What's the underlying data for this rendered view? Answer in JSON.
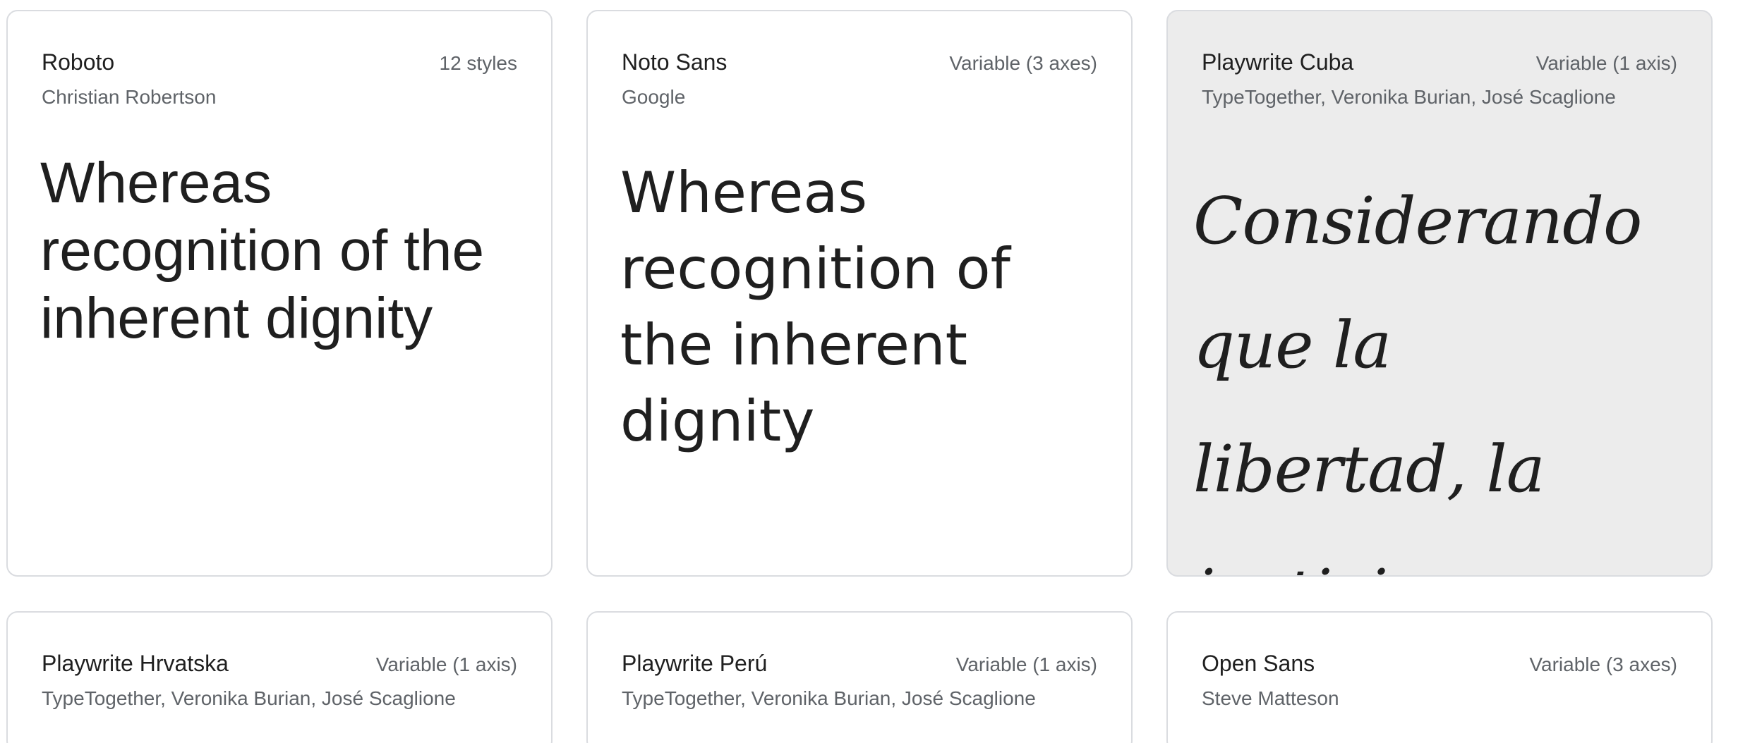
{
  "cards": [
    {
      "family": "Roboto",
      "styles": "12 styles",
      "designer": "Christian Robertson",
      "sample": "Whereas recognition of the inherent dignity"
    },
    {
      "family": "Noto Sans",
      "styles": "Variable (3 axes)",
      "designer": "Google",
      "sample": "Whereas recognition of the inherent dignity"
    },
    {
      "family": "Playwrite Cuba",
      "styles": "Variable (1 axis)",
      "designer": "TypeTogether, Veronika Burian, José Scaglione",
      "sample": "Considerando que la libertad, la justicia"
    },
    {
      "family": "Playwrite Hrvatska",
      "styles": "Variable (1 axis)",
      "designer": "TypeTogether, Veronika Burian, José Scaglione",
      "sample": ""
    },
    {
      "family": "Playwrite Perú",
      "styles": "Variable (1 axis)",
      "designer": "TypeTogether, Veronika Burian, José Scaglione",
      "sample": ""
    },
    {
      "family": "Open Sans",
      "styles": "Variable (3 axes)",
      "designer": "Steve Matteson",
      "sample": ""
    }
  ],
  "colors": {
    "card_border": "#dadce0",
    "card_hover_background": "#ececec",
    "primary_text": "#1f1f1f",
    "secondary_text": "#5f6368"
  }
}
